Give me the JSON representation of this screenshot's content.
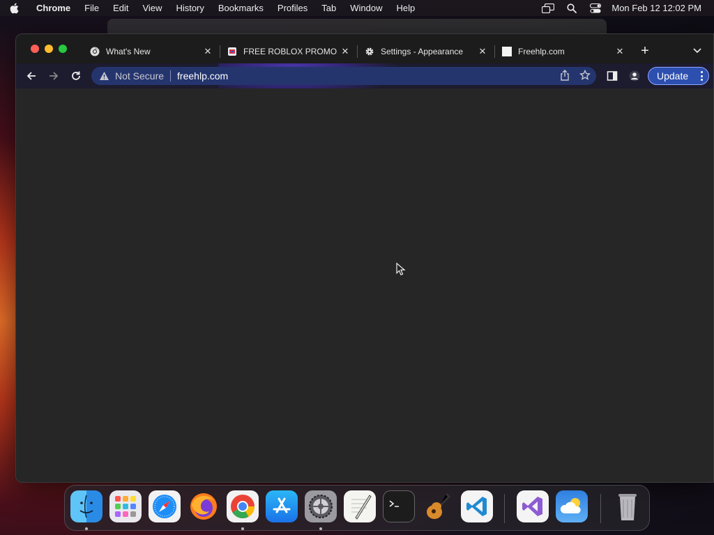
{
  "menubar": {
    "app_name": "Chrome",
    "items": [
      "File",
      "Edit",
      "View",
      "History",
      "Bookmarks",
      "Profiles",
      "Tab",
      "Window",
      "Help"
    ],
    "clock": "Mon Feb 12  12:02 PM"
  },
  "tabs": [
    {
      "title": "What's New",
      "icon": "chrome-icon"
    },
    {
      "title": "FREE ROBLOX PROMO",
      "icon": "roblox-icon"
    },
    {
      "title": "Settings - Appearance",
      "icon": "gear-icon"
    },
    {
      "title": "Freehlp.com",
      "icon": "blank-page-icon"
    }
  ],
  "omnibox": {
    "security_label": "Not Secure",
    "url": "freehlp.com"
  },
  "toolbar": {
    "update_label": "Update"
  },
  "dock": {
    "apps": [
      "Finder",
      "Launchpad",
      "Safari",
      "Firefox",
      "Google Chrome",
      "App Store",
      "System Preferences",
      "TextEdit",
      "Terminal",
      "GarageBand",
      "Visual Studio Code",
      "Visual Studio",
      "Weather",
      "Trash"
    ]
  },
  "colors": {
    "omnibox_bg": "#24356e",
    "update_button": "#2d4fb0",
    "content_bg": "#262626"
  }
}
